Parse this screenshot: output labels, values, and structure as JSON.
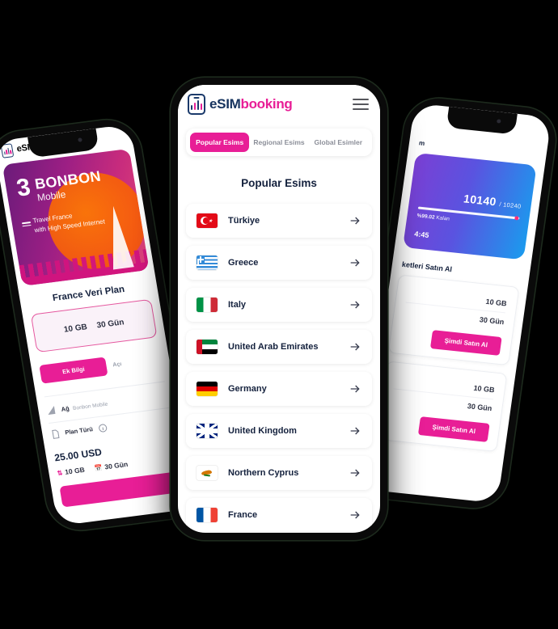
{
  "app": {
    "logo_primary": "eSIM",
    "logo_secondary": "booking",
    "accent_pink": "#E81E96",
    "navy": "#16335E"
  },
  "center_phone": {
    "menu_icon": "hamburger-menu-icon",
    "tabs": [
      {
        "label": "Popular Esims",
        "active": true
      },
      {
        "label": "Regional Esims",
        "active": false
      },
      {
        "label": "Global Esimler",
        "active": false
      }
    ],
    "heading": "Popular Esims",
    "countries": [
      {
        "name": "Türkiye",
        "flag": "flag-turkey-icon"
      },
      {
        "name": "Greece",
        "flag": "flag-greece-icon"
      },
      {
        "name": "Italy",
        "flag": "flag-italy-icon"
      },
      {
        "name": "United Arab Emirates",
        "flag": "flag-uae-icon"
      },
      {
        "name": "Germany",
        "flag": "flag-germany-icon"
      },
      {
        "name": "United Kingdom",
        "flag": "flag-uk-icon"
      },
      {
        "name": "Northern Cyprus",
        "flag": "flag-northern-cyprus-icon"
      },
      {
        "name": "France",
        "flag": "flag-france-icon"
      }
    ],
    "row_arrow_icon": "arrow-right-icon"
  },
  "left_phone": {
    "banner": {
      "number": "3",
      "brand_line1": "BONBON",
      "brand_line2": "Mobile",
      "tagline_line1": "Travel France",
      "tagline_line2": "with High Speed Internet"
    },
    "title": "France Veri Plan",
    "plan_data": "10 GB",
    "plan_days": "30 Gün",
    "info_button": "Ek Bilgi",
    "info_link": "Açı",
    "rows": [
      {
        "label": "Ağ",
        "sub": "Bonbon Mobile",
        "icon": "signal-icon"
      },
      {
        "label": "Plan Türü",
        "sub": "",
        "icon": "document-icon"
      }
    ],
    "price": "25.00 USD",
    "meta_data": "10 GB",
    "meta_days": "30 Gün"
  },
  "right_phone": {
    "top_text": "m",
    "usage_value": "10140",
    "usage_total": "/ 10240",
    "remaining": "%99.02",
    "remaining_label": "Kalan",
    "timer": "4:45",
    "heading": "ketleri Satın Al",
    "packages": [
      {
        "data": "10 GB",
        "days": "30 Gün",
        "buy": "Şimdi Satın Al"
      },
      {
        "data": "10 GB",
        "days": "30 Gün",
        "buy": "Şimdi Satın Al"
      }
    ]
  }
}
